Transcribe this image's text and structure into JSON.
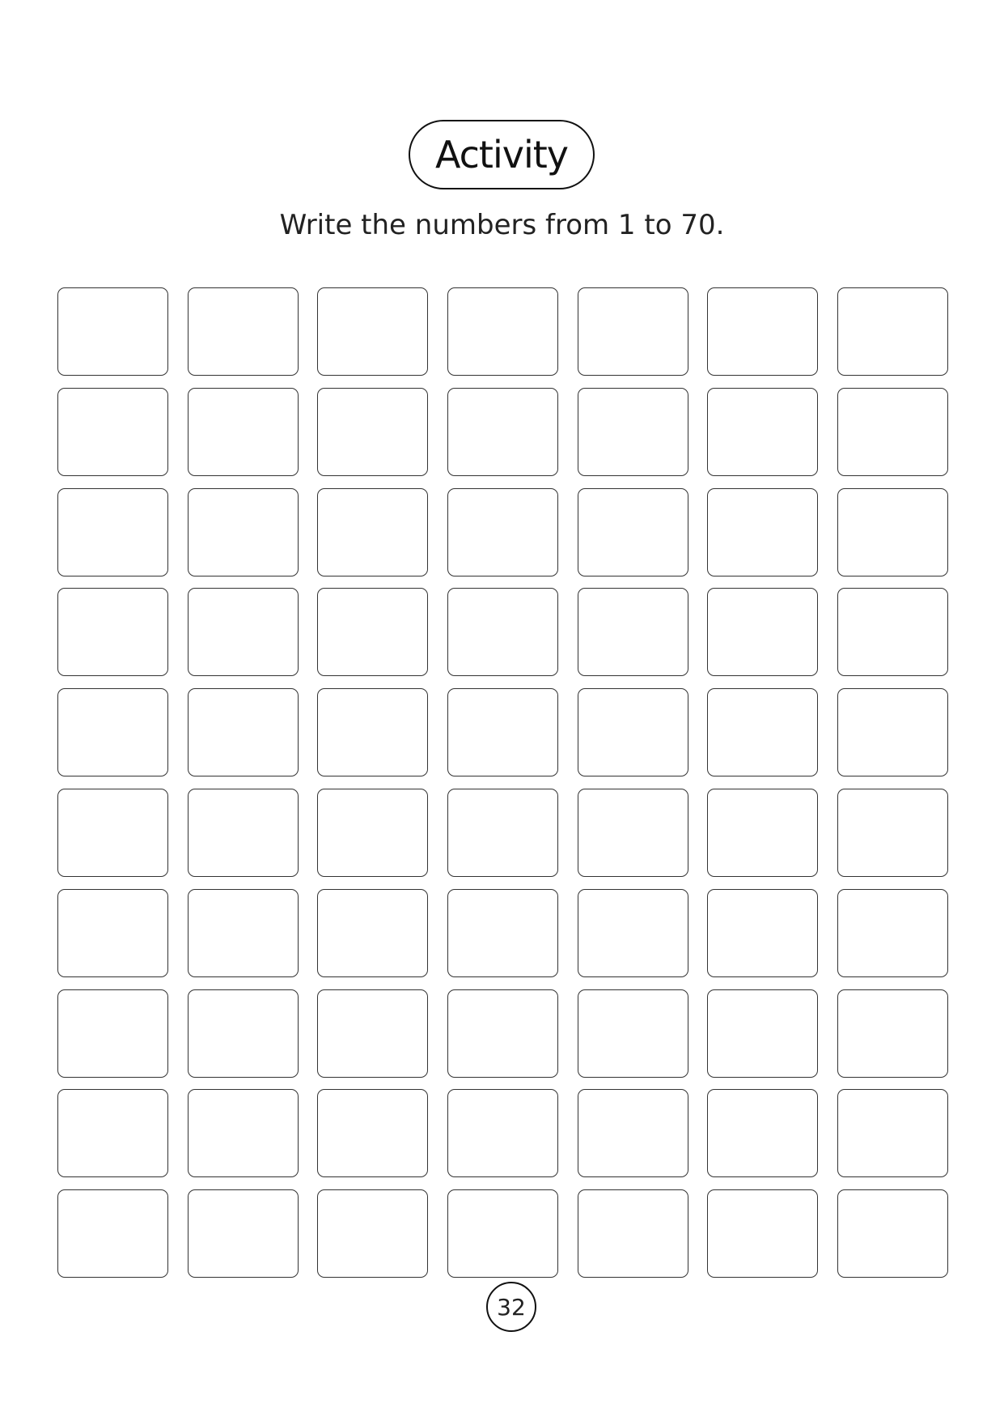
{
  "heading": {
    "title": "Activity",
    "instruction": "Write the numbers from 1 to 70."
  },
  "grid": {
    "rows": 10,
    "columns": 7,
    "cell_count": 70
  },
  "footer": {
    "page_number": "32"
  },
  "colors": {
    "ink": "#111111",
    "background": "#ffffff"
  }
}
